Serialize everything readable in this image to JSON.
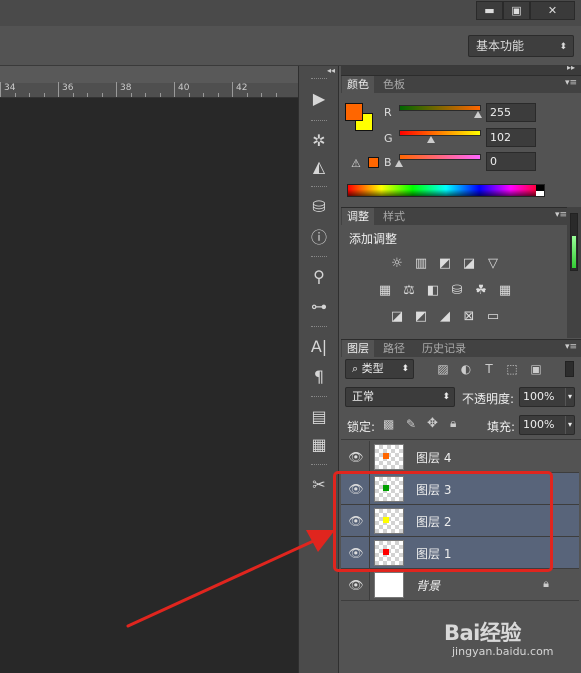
{
  "window": {
    "minimize": "▬",
    "restore": "▣",
    "close": "✕"
  },
  "workspace": {
    "label": "基本功能"
  },
  "ruler": {
    "labels": [
      "34",
      "36",
      "38",
      "40",
      "42"
    ]
  },
  "color_panel": {
    "tabs": [
      "颜色",
      "色板"
    ],
    "fg_color": "#ff6600",
    "bg_color": "#ffff00",
    "channels": [
      {
        "label": "R",
        "value": "255"
      },
      {
        "label": "G",
        "value": "102"
      },
      {
        "label": "B",
        "value": "0"
      }
    ],
    "warning_icon": "gamut-warning-icon"
  },
  "adjust_panel": {
    "tabs": [
      "调整",
      "样式"
    ],
    "title": "添加调整",
    "icons": [
      "brightness-icon",
      "levels-icon",
      "curves-icon",
      "exposure-icon",
      "vibrance-icon",
      "hue-icon",
      "color-balance-icon",
      "bw-icon",
      "photo-filter-icon",
      "channel-mixer-icon",
      "color-lookup-icon",
      "invert-icon",
      "posterize-icon",
      "threshold-icon",
      "selective-color-icon",
      "gradient-map-icon"
    ]
  },
  "layers_panel": {
    "tabs": [
      "图层",
      "路径",
      "历史记录"
    ],
    "filter_label": "类型",
    "blend_mode": "正常",
    "opacity_label": "不透明度:",
    "opacity_value": "100%",
    "lock_label": "锁定:",
    "fill_label": "填充:",
    "fill_value": "100%",
    "layers": [
      {
        "name": "图层 4",
        "dot": "#ff6600",
        "selected": false
      },
      {
        "name": "图层 3",
        "dot": "#00a000",
        "selected": true
      },
      {
        "name": "图层 2",
        "dot": "#ffff00",
        "selected": true
      },
      {
        "name": "图层 1",
        "dot": "#ff0000",
        "selected": true
      },
      {
        "name": "背景",
        "dot": null,
        "selected": false
      }
    ]
  },
  "annotation": {
    "highlight_color": "#e0251e"
  },
  "watermark": {
    "brand": "Bai经验",
    "url": "jingyan.baidu.com"
  }
}
